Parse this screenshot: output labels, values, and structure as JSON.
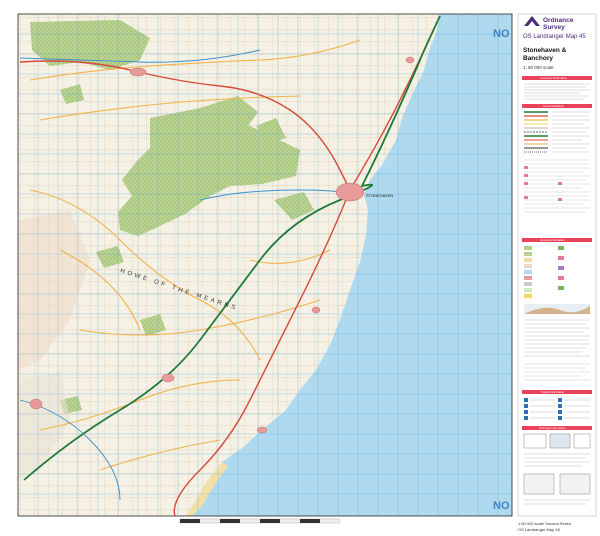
{
  "brand": {
    "line1": "Ordnance",
    "line2": "Survey"
  },
  "series": "OS Landranger Map 45",
  "title": {
    "line1": "Stonehaven &",
    "line2": "Banchory"
  },
  "scale": "1: 50 000 scale",
  "grid_square": "NO",
  "place_labels": {
    "town": "STONEHAVEN",
    "howe": "HOWE OF THE MEARNS"
  },
  "legend_sections": [
    "Customer Information",
    "Communications",
    "General Information",
    "Tourist Information",
    "Technical Information"
  ],
  "footer": {
    "line1": "1:50 000 scale Second Series",
    "line2": "OS Landranger Map 45"
  },
  "colors": {
    "sea": "#aed9ef",
    "land": "#f6f3e8",
    "forest": "#b7d08a",
    "brand_purple": "#4b2a7b",
    "railway": "#1f7a3a",
    "grid": "#62a9d6"
  }
}
